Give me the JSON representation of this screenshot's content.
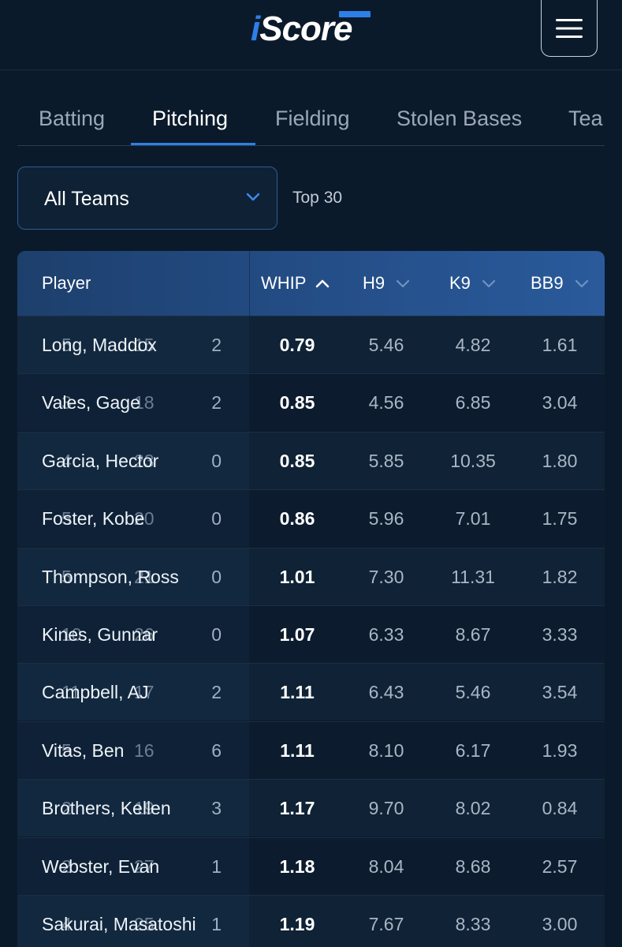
{
  "header": {
    "logo_text_i": "i",
    "logo_text_rest": "Score",
    "colors": {
      "accent": "#2e7fe8",
      "background": "#0b1a2b",
      "header_blue": "#234c84"
    },
    "menu_icon": "hamburger-icon"
  },
  "tabs": [
    {
      "label": "Batting",
      "active": false
    },
    {
      "label": "Pitching",
      "active": true
    },
    {
      "label": "Fielding",
      "active": false
    },
    {
      "label": "Stolen Bases",
      "active": false
    },
    {
      "label": "Tea",
      "active": false
    }
  ],
  "filter": {
    "team_select": "All Teams",
    "chevron_icon": "chevron-down-icon",
    "top_label": "Top 30"
  },
  "table": {
    "headers": {
      "player": "Player",
      "whip": "WHIP",
      "h9": "H9",
      "k9": "K9",
      "bb9": "BB9"
    },
    "sort": {
      "column": "WHIP",
      "direction": "ascending"
    },
    "rows": [
      {
        "under1": "5",
        "name": "Long, Maddox",
        "under2": "15",
        "g": "2",
        "whip": "0.79",
        "h9": "5.46",
        "k9": "4.82",
        "bb9": "1.61"
      },
      {
        "under1": "3",
        "name": "Vales, Gage",
        "under2": "18",
        "g": "2",
        "whip": "0.85",
        "h9": "4.56",
        "k9": "6.85",
        "bb9": "3.04"
      },
      {
        "under1": "4",
        "name": "Garcia, Hector",
        "under2": "23",
        "g": "0",
        "whip": "0.85",
        "h9": "5.85",
        "k9": "10.35",
        "bb9": "1.80"
      },
      {
        "under1": "5",
        "name": "Foster, Kobe",
        "under2": "20",
        "g": "0",
        "whip": "0.86",
        "h9": "5.96",
        "k9": "7.01",
        "bb9": "1.75"
      },
      {
        "under1": "5",
        "name": "Thompson, Ross",
        "under2": "21",
        "g": "0",
        "whip": "1.01",
        "h9": "7.30",
        "k9": "11.31",
        "bb9": "1.82"
      },
      {
        "under1": "10",
        "name": "Kines, Gunnar",
        "under2": "26",
        "g": "0",
        "whip": "1.07",
        "h9": "6.33",
        "k9": "8.67",
        "bb9": "3.33"
      },
      {
        "under1": "11",
        "name": "Campbell, AJ",
        "under2": "17",
        "g": "2",
        "whip": "1.11",
        "h9": "6.43",
        "k9": "5.46",
        "bb9": "3.54"
      },
      {
        "under1": "5",
        "name": "Vitas, Ben",
        "under2": "16",
        "g": "6",
        "whip": "1.11",
        "h9": "8.10",
        "k9": "6.17",
        "bb9": "1.93"
      },
      {
        "under1": "2",
        "name": "Brothers, Kellen",
        "under2": "19",
        "g": "3",
        "whip": "1.17",
        "h9": "9.70",
        "k9": "8.02",
        "bb9": "0.84"
      },
      {
        "under1": "2",
        "name": "Webster, Evan",
        "under2": "27",
        "g": "1",
        "whip": "1.18",
        "h9": "8.04",
        "k9": "8.68",
        "bb9": "2.57"
      },
      {
        "under1": "4",
        "name": "Sakurai, Masatoshi",
        "under2": "25",
        "g": "1",
        "whip": "1.19",
        "h9": "7.67",
        "k9": "8.33",
        "bb9": "3.00"
      }
    ]
  }
}
